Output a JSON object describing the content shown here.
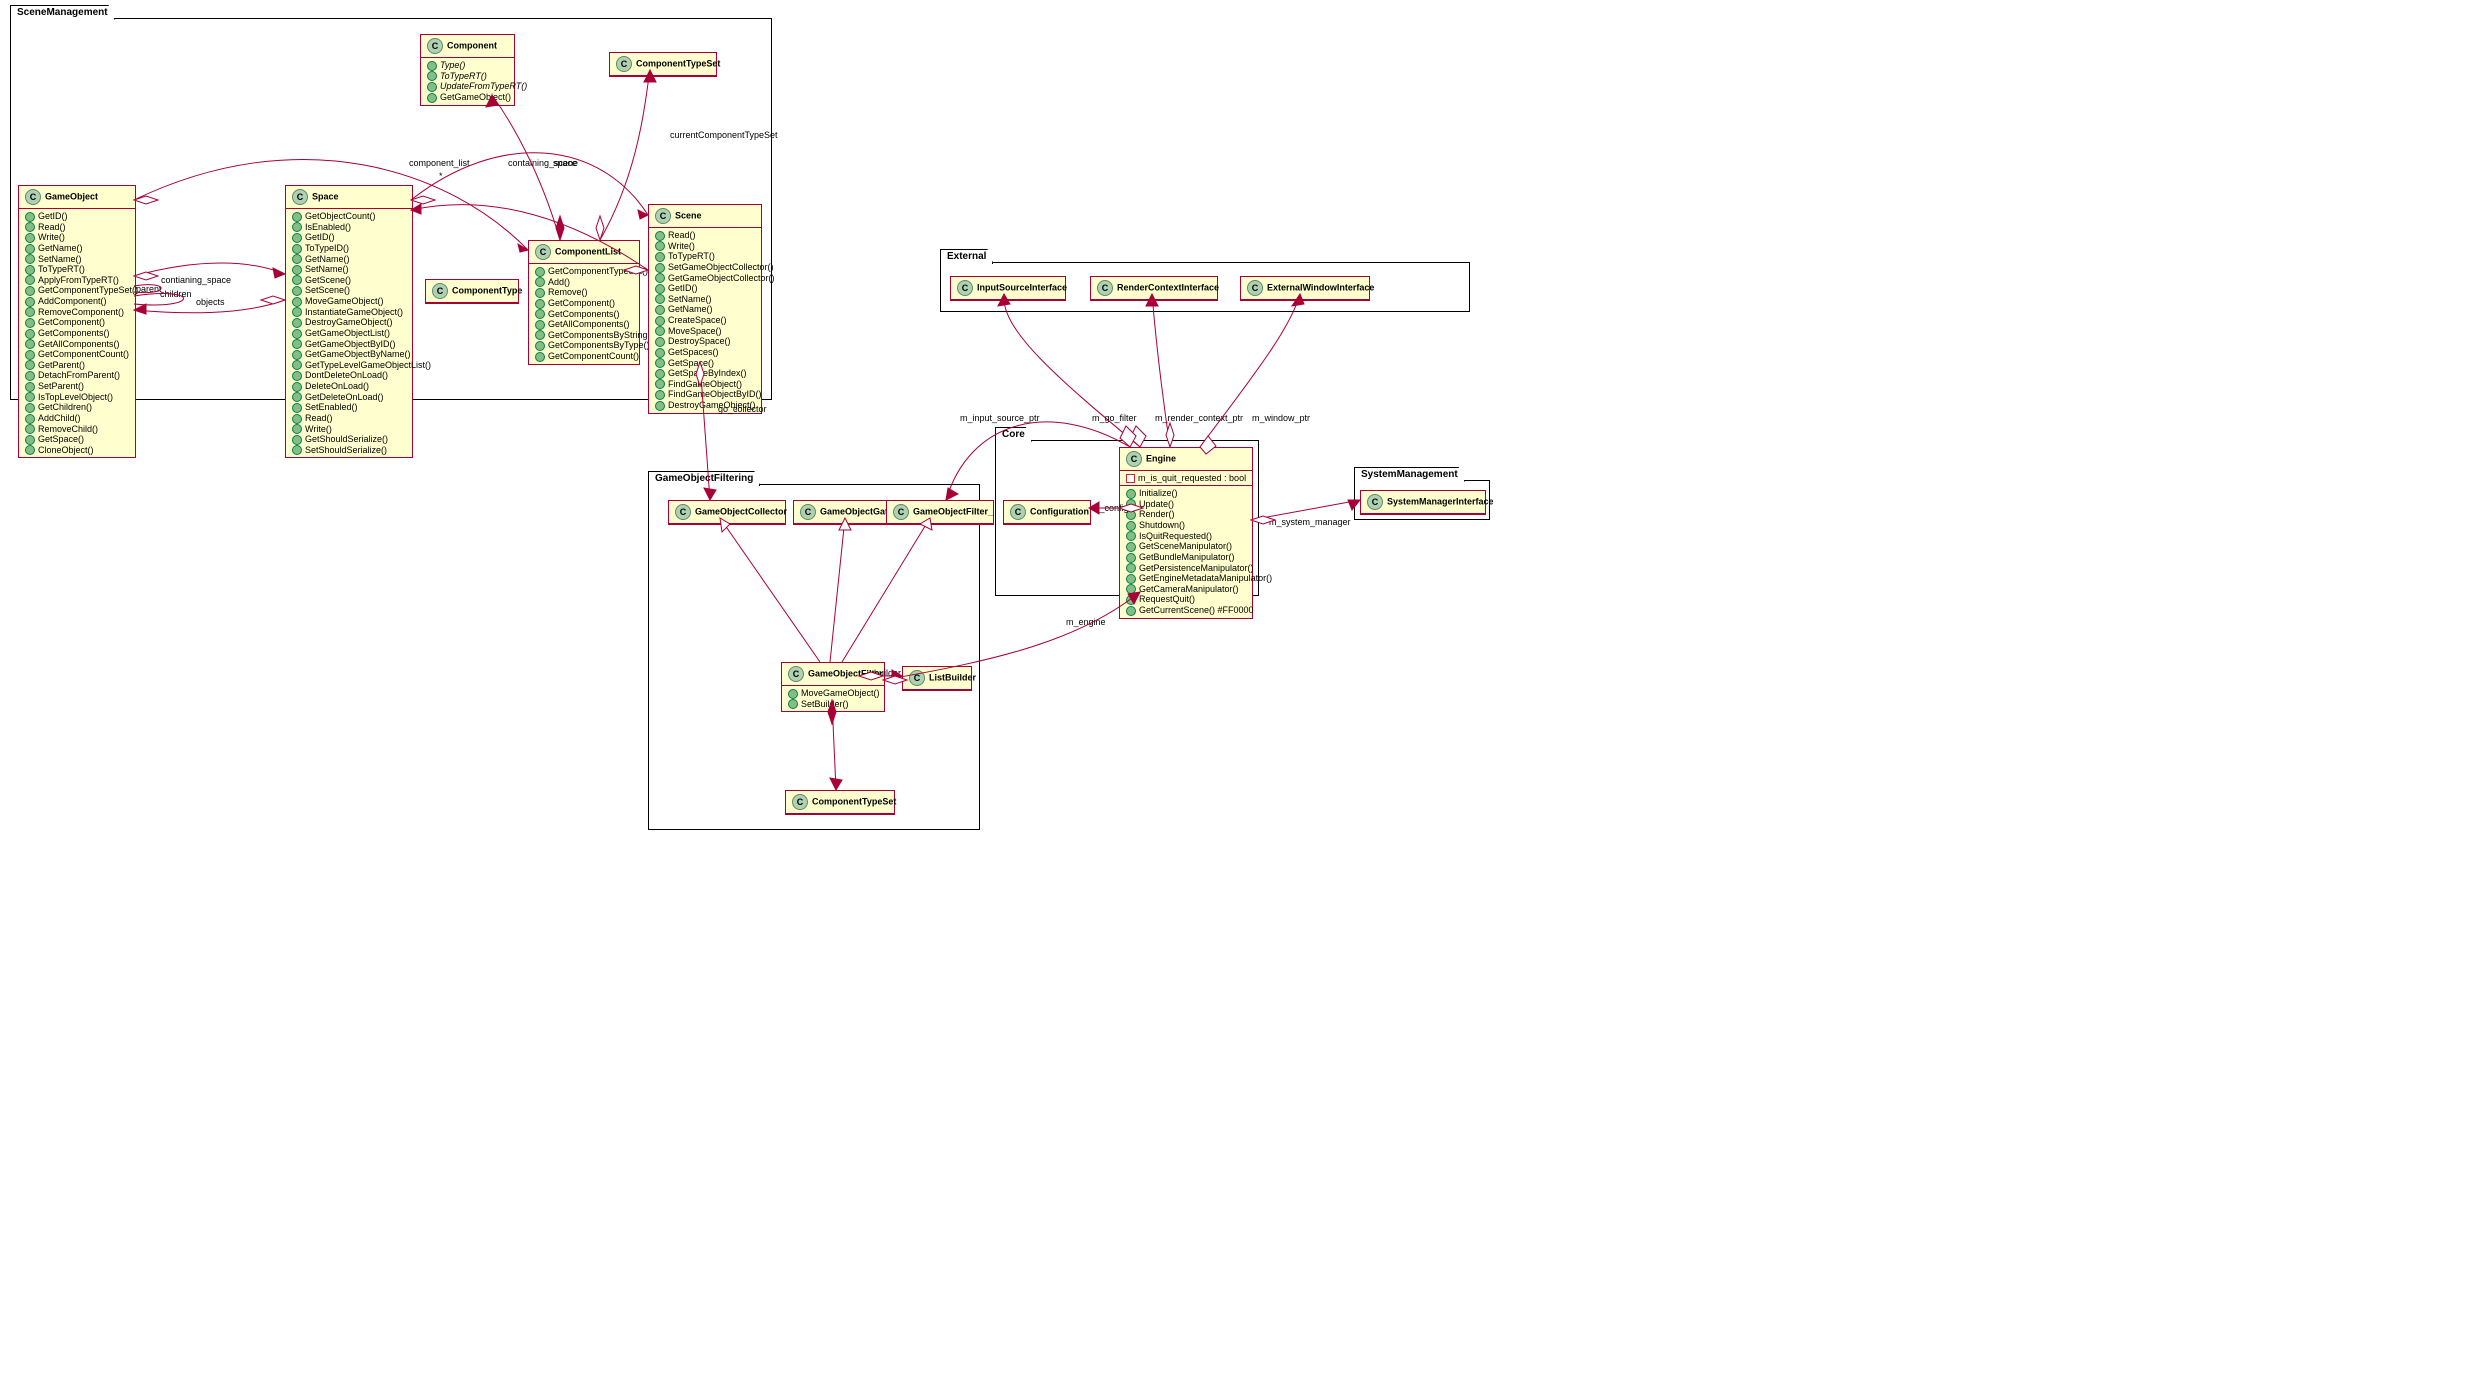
{
  "packages": {
    "scene_mgmt": {
      "label": "SceneManagement"
    },
    "external": {
      "label": "External"
    },
    "core": {
      "label": "Core"
    },
    "go_filter": {
      "label": "GameObjectFiltering"
    },
    "sys_mgmt": {
      "label": "SystemManagement"
    }
  },
  "classes": {
    "gameobject": {
      "name": "GameObject",
      "methods": [
        "GetID()",
        "Read()",
        "Write()",
        "GetName()",
        "SetName()",
        "ToTypeRT()",
        "ApplyFromTypeRT()",
        "GetComponentTypeSet()",
        "AddComponent()",
        "RemoveComponent()",
        "GetComponent()",
        "GetComponents()",
        "GetAllComponents()",
        "GetComponentCount()",
        "GetParent()",
        "DetachFromParent()",
        "SetParent()",
        "IsTopLevelObject()",
        "GetChildren()",
        "AddChild()",
        "RemoveChild()",
        "GetSpace()",
        "CloneObject()"
      ]
    },
    "component": {
      "name": "Component",
      "abstract": [
        "Type()",
        "ToTypeRT()",
        "UpdateFromTypeRT()"
      ],
      "methods": [
        "GetGameObject()"
      ]
    },
    "space": {
      "name": "Space",
      "methods": [
        "GetObjectCount()",
        "IsEnabled()",
        "GetID()",
        "ToTypeID()",
        "GetName()",
        "SetName()",
        "GetScene()",
        "SetScene()",
        "MoveGameObject()",
        "InstantiateGameObject()",
        "DestroyGameObject()",
        "GetGameObjectList()",
        "GetGameObjectByID()",
        "GetGameObjectByName()",
        "GetTypeLevelGameObjectList()",
        "DontDeleteOnLoad()",
        "DeleteOnLoad()",
        "GetDeleteOnLoad()",
        "SetEnabled()",
        "Read()",
        "Write()",
        "GetShouldSerialize()",
        "SetShouldSerialize()"
      ]
    },
    "componenttypeset": {
      "name": "ComponentTypeSet"
    },
    "componentlist": {
      "name": "ComponentList",
      "methods": [
        "GetComponentTypeSet()",
        "Add()",
        "Remove()",
        "GetComponent()",
        "GetComponents()",
        "GetAllComponents()",
        "GetComponentsByString()",
        "GetComponentsByType()",
        "GetComponentCount()"
      ]
    },
    "componenttype": {
      "name": "ComponentType"
    },
    "scene": {
      "name": "Scene",
      "methods": [
        "Read()",
        "Write()",
        "ToTypeRT()",
        "SetGameObjectCollector()",
        "GetGameObjectCollector()",
        "GetID()",
        "SetName()",
        "GetName()",
        "CreateSpace()",
        "MoveSpace()",
        "DestroySpace()",
        "GetSpaces()",
        "GetSpace()",
        "GetSpaceByIndex()",
        "FindGameObject()",
        "FindGameObjectByID()",
        "DestroyGameObject()"
      ]
    },
    "inputsrc": {
      "name": "InputSourceInterface"
    },
    "renderctx": {
      "name": "RenderContextInterface"
    },
    "extwin": {
      "name": "ExternalWindowInterface"
    },
    "config": {
      "name": "Configuration"
    },
    "engine": {
      "name": "Engine",
      "fields": [
        {
          "vis": "priv",
          "text": "m_is_quit_requested : bool"
        }
      ],
      "methods": [
        "Initialize()",
        "Update()",
        "Render()",
        "Shutdown()",
        "IsQuitRequested()",
        "GetSceneManipulator()",
        "GetBundleManipulator()",
        "GetPersistenceManipulator()",
        "GetEngineMetadataManipulator()",
        "GetCameraManipulator()",
        "RequestQuit()",
        "GetCurrentScene() #FF0000"
      ]
    },
    "sysmgr": {
      "name": "SystemManagerInterface"
    },
    "gocollector": {
      "name": "GameObjectCollector"
    },
    "gogatherer": {
      "name": "GameObjectGatherer"
    },
    "gofilter_if": {
      "name": "GameObjectFilter_"
    },
    "gofilter": {
      "name": "GameObjectFilter",
      "methods": [
        "MoveGameObject()",
        "SetBuilder()"
      ]
    },
    "listbuilder": {
      "name": "ListBuilder"
    },
    "componenttypeset2": {
      "name": "ComponentTypeSet"
    }
  },
  "labels": {
    "component_list": "component_list",
    "containing_scene": "containing_scene",
    "space": "space",
    "currentComponentTypeSet": "currentComponentTypeSet",
    "go_collector": "go_collector",
    "containing_space": "contianing_space",
    "parent": "parent",
    "children": "children",
    "objects": "objects",
    "m_input_source_ptr": "m_input_source_ptr",
    "m_go_filter": "m_go_filter",
    "m_render_context_ptr": "m_render_context_ptr",
    "m_window_ptr": "m_window_ptr",
    "m_config": "m_config",
    "m_system_manager": "m_system_manager",
    "m_engine": "m_engine",
    "builder": "builder",
    "star": "*"
  }
}
